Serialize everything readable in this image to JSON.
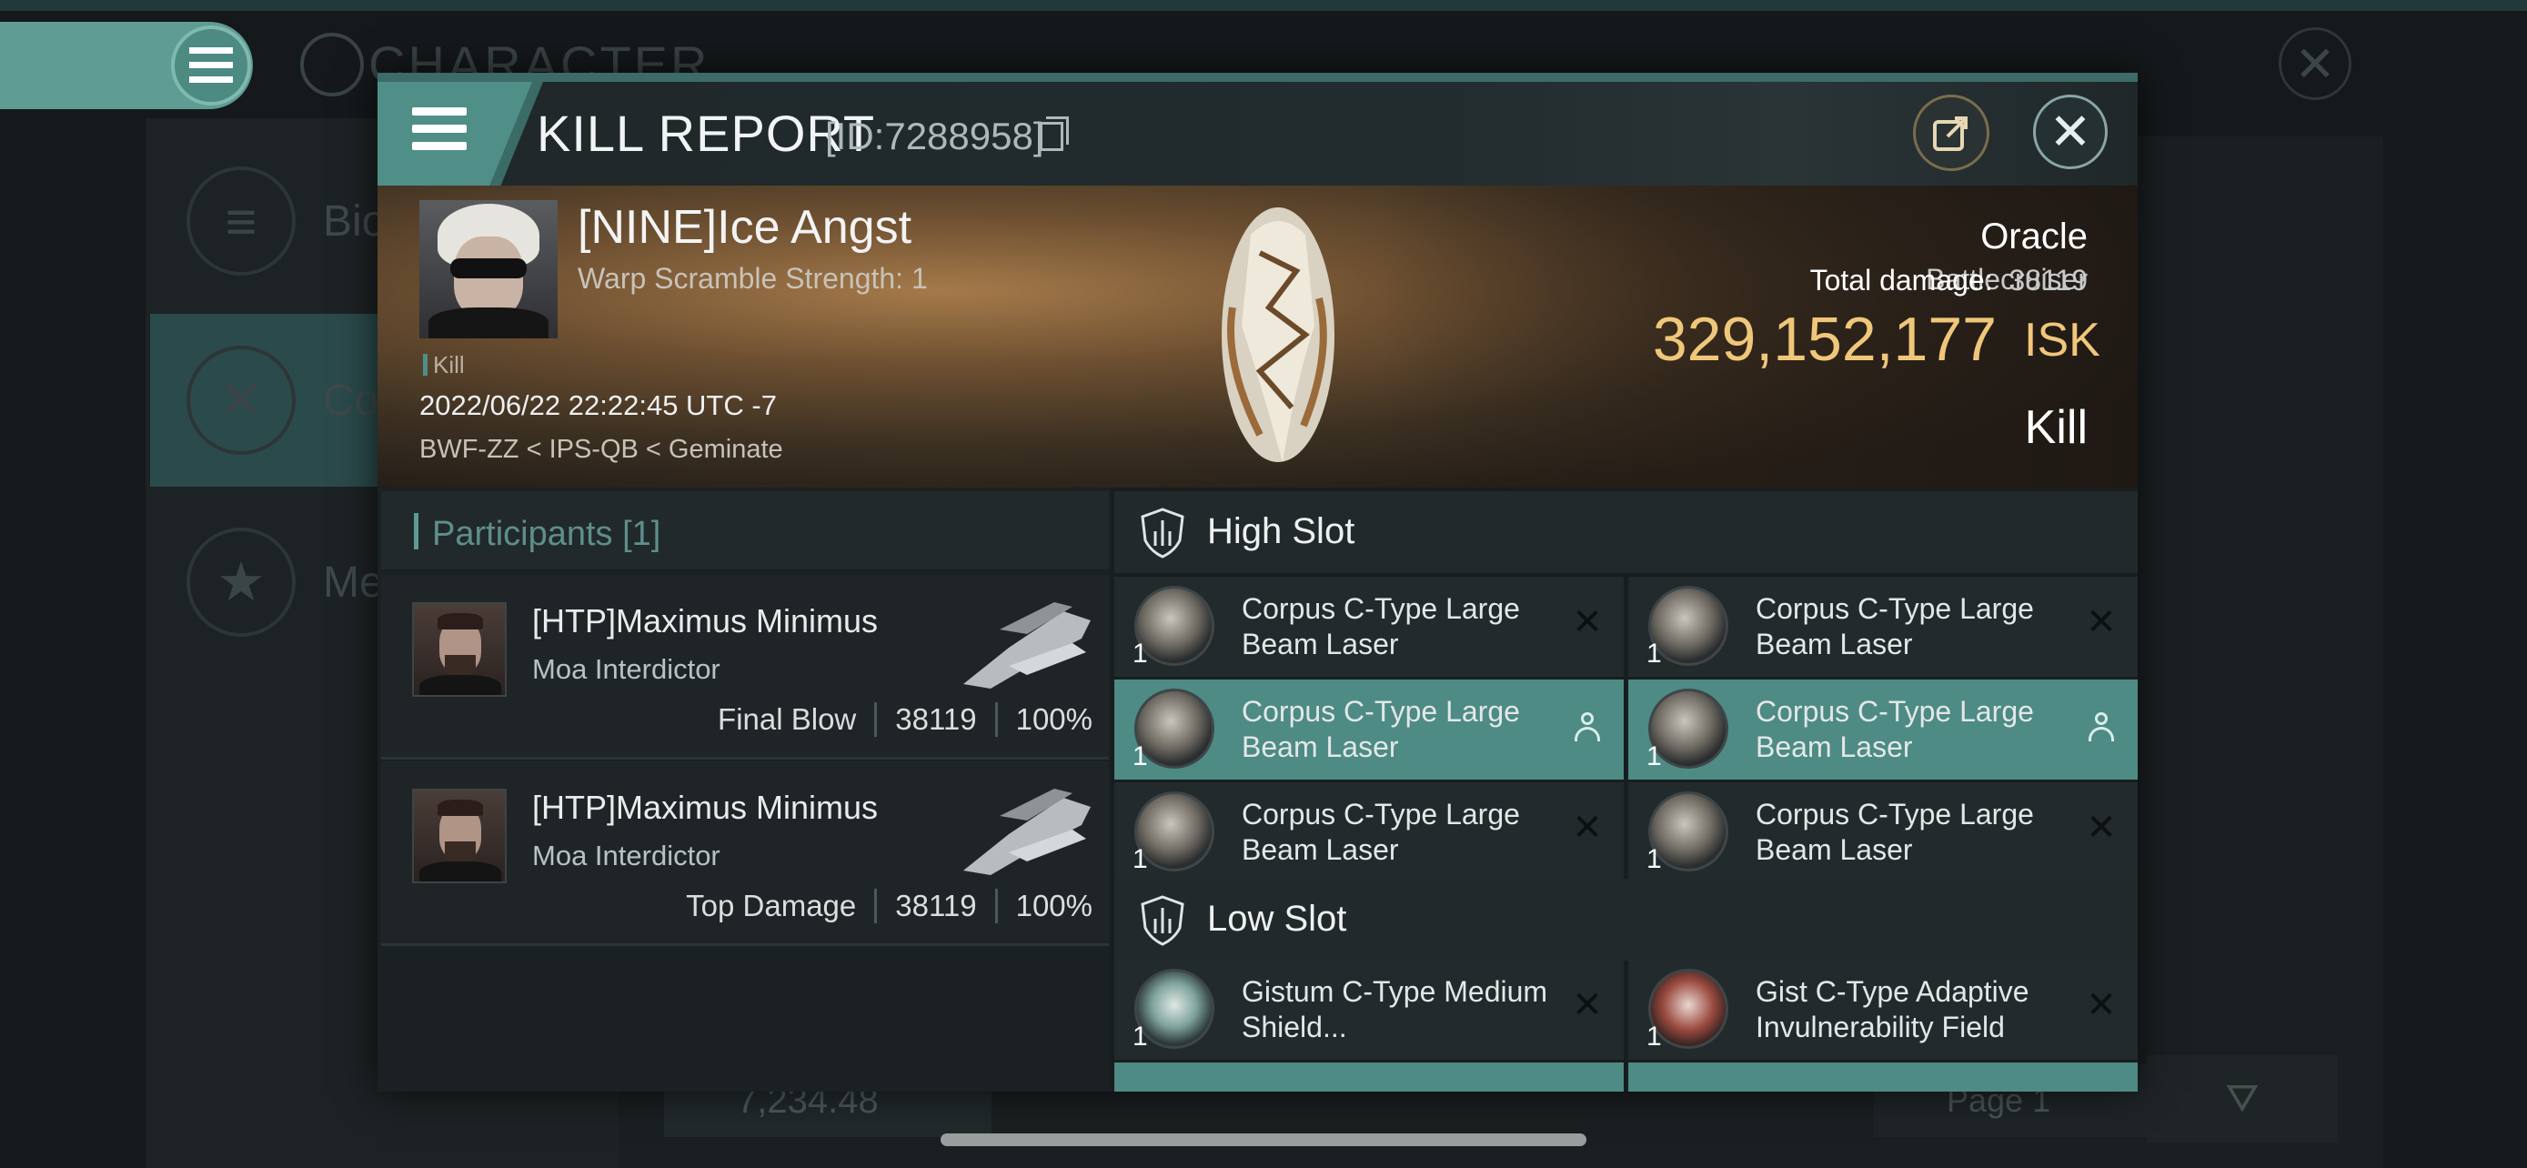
{
  "background": {
    "title": "CHARACTER",
    "sidebar": [
      {
        "label": "Bio",
        "icon": "list-icon"
      },
      {
        "label": "Co",
        "icon": "crossed-swords-icon"
      },
      {
        "label": "Me",
        "icon": "star-icon"
      }
    ],
    "bottom_value": "7,234.48",
    "page_label": "Page 1"
  },
  "modal": {
    "title": "KILL REPORT",
    "report_id": "[ID:7288958]",
    "victim": {
      "name": "[NINE]Ice Angst",
      "scramble": "Warp Scramble Strength: 1",
      "tag": "Kill",
      "datetime": "2022/06/22 22:22:45 UTC -7",
      "location": "BWF-ZZ < IPS-QB < Geminate"
    },
    "ship": {
      "name": "Oracle",
      "class": "Battlecruiser",
      "total_damage_label": "Total damage:",
      "total_damage": "38119",
      "isk_value": "329,152,177",
      "isk_unit": "ISK",
      "result": "Kill"
    },
    "participants": {
      "title": "Participants [1]",
      "rows": [
        {
          "name": "[HTP]Maximus Minimus",
          "ship": "Moa Interdictor",
          "role": "Final Blow",
          "damage": "38119",
          "percent": "100%"
        },
        {
          "name": "[HTP]Maximus Minimus",
          "ship": "Moa Interdictor",
          "role": "Top Damage",
          "damage": "38119",
          "percent": "100%"
        }
      ]
    },
    "slots": {
      "high": {
        "title": "High Slot",
        "modules": [
          {
            "name": "Corpus C-Type Large Beam Laser",
            "qty": "1",
            "state": "destroyed"
          },
          {
            "name": "Corpus C-Type Large Beam Laser",
            "qty": "1",
            "state": "destroyed"
          },
          {
            "name": "Corpus C-Type Large Beam Laser",
            "qty": "1",
            "state": "dropped"
          },
          {
            "name": "Corpus C-Type Large Beam Laser",
            "qty": "1",
            "state": "dropped"
          },
          {
            "name": "Corpus C-Type Large Beam Laser",
            "qty": "1",
            "state": "destroyed"
          },
          {
            "name": "Corpus C-Type Large Beam Laser",
            "qty": "1",
            "state": "destroyed"
          }
        ]
      },
      "low": {
        "title": "Low Slot",
        "modules": [
          {
            "name": "Gistum C-Type Medium Shield...",
            "qty": "1",
            "state": "destroyed"
          },
          {
            "name": "Gist C-Type Adaptive Invulnerability Field",
            "qty": "1",
            "state": "destroyed"
          }
        ]
      }
    }
  },
  "colors": {
    "accent": "#4d8b84",
    "isk": "#f0c77a"
  }
}
